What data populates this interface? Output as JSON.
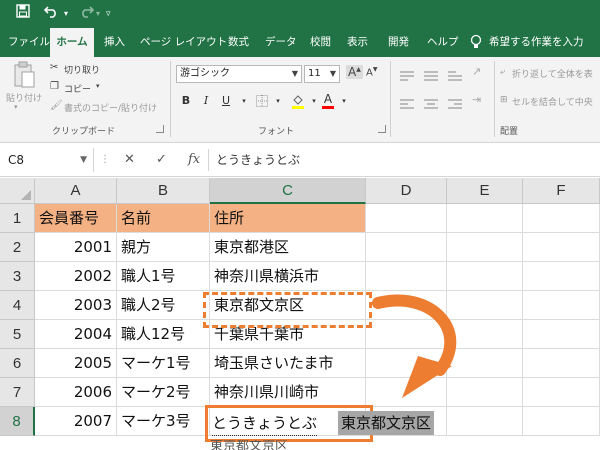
{
  "quick_access": {
    "save_icon": "save-icon",
    "undo_icon": "undo-icon",
    "redo_icon": "redo-icon",
    "customize_icon": "customize-qat-icon"
  },
  "ribbon_tabs": [
    {
      "label": "ファイル"
    },
    {
      "label": "ホーム"
    },
    {
      "label": "挿入"
    },
    {
      "label": "ページ レイアウト"
    },
    {
      "label": "数式"
    },
    {
      "label": "データ"
    },
    {
      "label": "校閲"
    },
    {
      "label": "表示"
    },
    {
      "label": "開発"
    },
    {
      "label": "ヘルプ"
    }
  ],
  "tell_me": "希望する作業を入力",
  "clipboard": {
    "paste": "貼り付け",
    "cut": "切り取り",
    "copy": "コピー",
    "format_painter": "書式のコピー/貼り付け",
    "group_label": "クリップボード"
  },
  "font": {
    "family": "游ゴシック",
    "size": "11",
    "grow": "A",
    "shrink": "A",
    "bold": "B",
    "italic": "I",
    "underline": "U",
    "font_color_letter": "A",
    "group_label": "フォント"
  },
  "alignment": {
    "wrap_text": "折り返して全体を表",
    "merge_center": "セルを結合して中央",
    "group_label": "配置"
  },
  "formula_bar": {
    "name_box": "C8",
    "cancel": "✕",
    "enter": "✓",
    "fx": "fx",
    "content": "とうきょうとぶ"
  },
  "columns": [
    "A",
    "B",
    "C",
    "D",
    "E",
    "F"
  ],
  "rows": [
    {
      "num": "1",
      "a": "会員番号",
      "b": "名前",
      "c": "住所"
    },
    {
      "num": "2",
      "a": "2001",
      "b": "親方",
      "c": "東京都港区"
    },
    {
      "num": "3",
      "a": "2002",
      "b": "職人1号",
      "c": "神奈川県横浜市"
    },
    {
      "num": "4",
      "a": "2003",
      "b": "職人2号",
      "c": "東京都文京区"
    },
    {
      "num": "5",
      "a": "2004",
      "b": "職人12号",
      "c": "千葉県千葉市"
    },
    {
      "num": "6",
      "a": "2005",
      "b": "マーケ1号",
      "c": "埼玉県さいたま市"
    },
    {
      "num": "7",
      "a": "2006",
      "b": "マーケ2号",
      "c": "神奈川県川崎市"
    },
    {
      "num": "8",
      "a": "2007",
      "b": "マーケ3号",
      "c": ""
    }
  ],
  "active_cell": "C8",
  "ime": {
    "typed": "とうきょうとぶ",
    "suggestion": "東京都文京区",
    "below_partial": "東京都文京区"
  },
  "colors": {
    "accent": "#217346",
    "header_fill": "#f4b183",
    "highlight": "#ed7d31"
  }
}
